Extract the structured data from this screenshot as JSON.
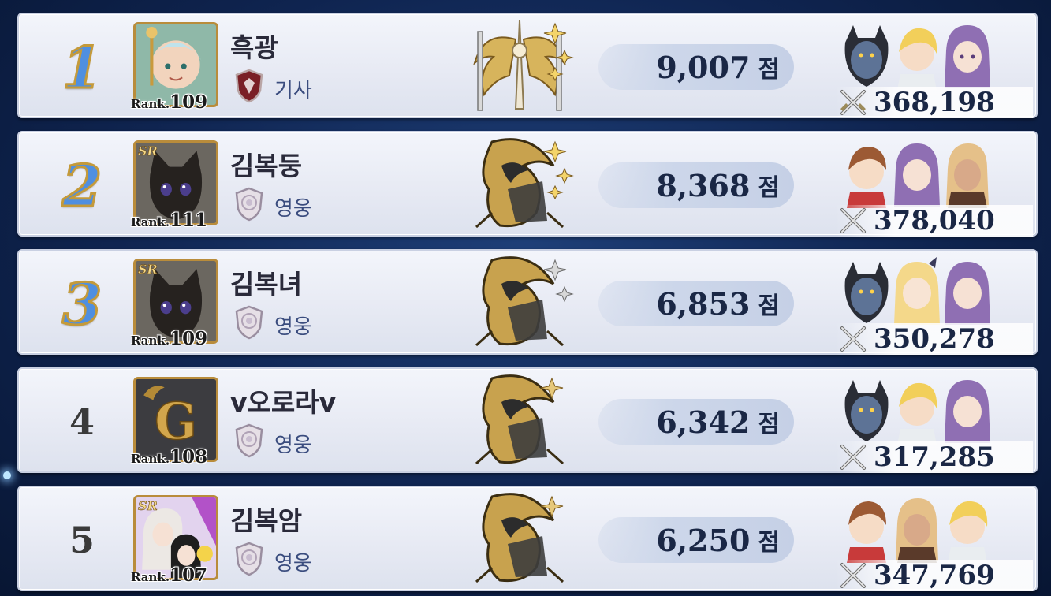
{
  "leaderboard": {
    "rows": [
      {
        "rank": "1",
        "name": "흑광",
        "level_label": "Rank.",
        "level": "109",
        "tier": "기사",
        "score": "9,007",
        "score_unit": "점",
        "power": "368,198",
        "tier_icon": "knight-shield-icon",
        "emblem": "golden-wings-sword-emblem"
      },
      {
        "rank": "2",
        "name": "김복둥",
        "level_label": "Rank.",
        "level": "111",
        "tier": "영웅",
        "score": "8,368",
        "score_unit": "점",
        "power": "378,040",
        "tier_icon": "hero-shield-icon",
        "emblem": "dragon-emblem"
      },
      {
        "rank": "3",
        "name": "김복녀",
        "level_label": "Rank.",
        "level": "109",
        "tier": "영웅",
        "score": "6,853",
        "score_unit": "점",
        "power": "350,278",
        "tier_icon": "hero-shield-icon",
        "emblem": "dragon-emblem"
      },
      {
        "rank": "4",
        "name": "v오로라v",
        "level_label": "Rank.",
        "level": "108",
        "tier": "영웅",
        "score": "6,342",
        "score_unit": "점",
        "power": "317,285",
        "tier_icon": "hero-shield-icon",
        "emblem": "dragon-emblem"
      },
      {
        "rank": "5",
        "name": "김복암",
        "level_label": "Rank.",
        "level": "107",
        "tier": "영웅",
        "score": "6,250",
        "score_unit": "점",
        "power": "347,769",
        "tier_icon": "hero-shield-icon",
        "emblem": "dragon-emblem"
      }
    ]
  },
  "colors": {
    "accent_gold": "#c49a3a",
    "rank_blue": "#4f8fe0",
    "text_dark": "#1a2745",
    "tier_text": "#3a4c7e"
  }
}
